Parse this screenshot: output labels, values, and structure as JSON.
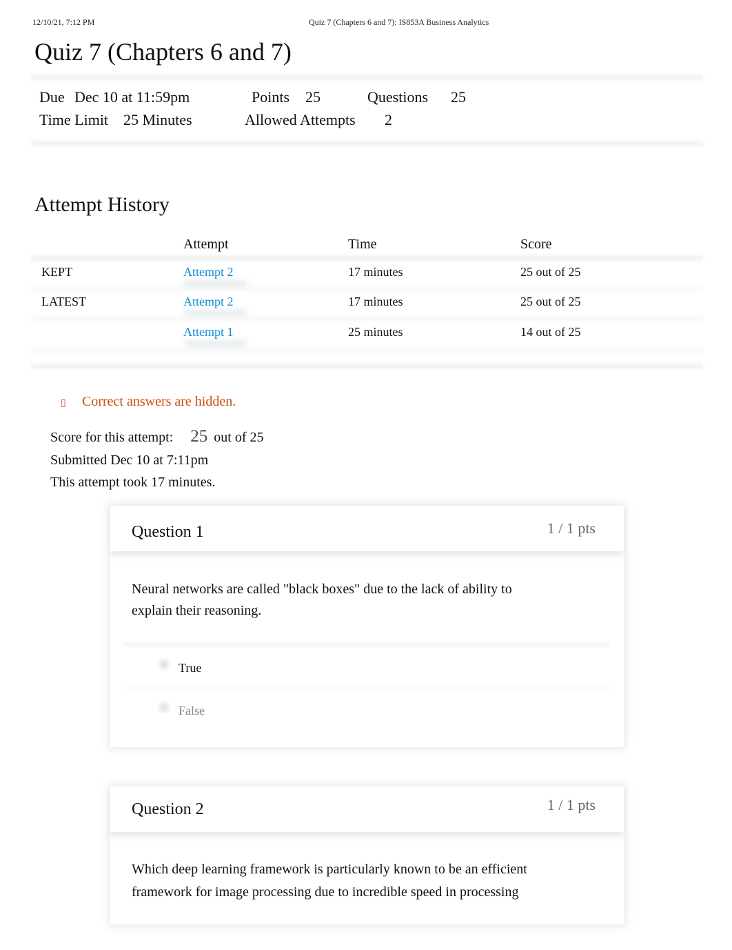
{
  "print_header": {
    "date": "12/10/21, 7:12 PM",
    "title": "Quiz 7 (Chapters 6 and 7): IS853A Business Analytics"
  },
  "page_title": "Quiz 7 (Chapters 6 and 7)",
  "quiz_meta": {
    "due_label": "Due",
    "due_value": "Dec 10 at 11:59pm",
    "points_label": "Points",
    "points_value": "25",
    "questions_label": "Questions",
    "questions_value": "25",
    "time_limit_label": "Time Limit",
    "time_limit_value": "25 Minutes",
    "allowed_attempts_label": "Allowed Attempts",
    "allowed_attempts_value": "2"
  },
  "attempt_history": {
    "title": "Attempt History",
    "columns": [
      "",
      "Attempt",
      "Time",
      "Score"
    ],
    "rows": [
      {
        "tag": "KEPT",
        "attempt": "Attempt 2",
        "time": "17 minutes",
        "score": "25 out of 25"
      },
      {
        "tag": "LATEST",
        "attempt": "Attempt 2",
        "time": "17 minutes",
        "score": "25 out of 25"
      },
      {
        "tag": "",
        "attempt": "Attempt 1",
        "time": "25 minutes",
        "score": "14 out of 25"
      }
    ]
  },
  "notice": {
    "icon": "info-icon",
    "icon_glyph": "▯",
    "text": "Correct answers are hidden."
  },
  "summary": {
    "score_label": "Score for this attempt:",
    "score_value": "25",
    "score_suffix": "out of 25",
    "submitted": "Submitted Dec 10 at 7:11pm",
    "duration": "This attempt took 17 minutes."
  },
  "questions": [
    {
      "name": "Question 1",
      "points": "1 / 1 pts",
      "text": "Neural networks are called \"black boxes\" due to the lack of ability to explain their reasoning.",
      "answers": [
        {
          "label": "True",
          "selected": true
        },
        {
          "label": "False",
          "selected": false
        }
      ]
    },
    {
      "name": "Question 2",
      "points": "1 / 1 pts",
      "text": "Which deep learning framework is particularly known to be an efficient framework for image processing due to incredible speed in processing"
    }
  ],
  "colors": {
    "link": "#0f8bd8",
    "notice": "#d04a10",
    "muted": "#666666"
  }
}
